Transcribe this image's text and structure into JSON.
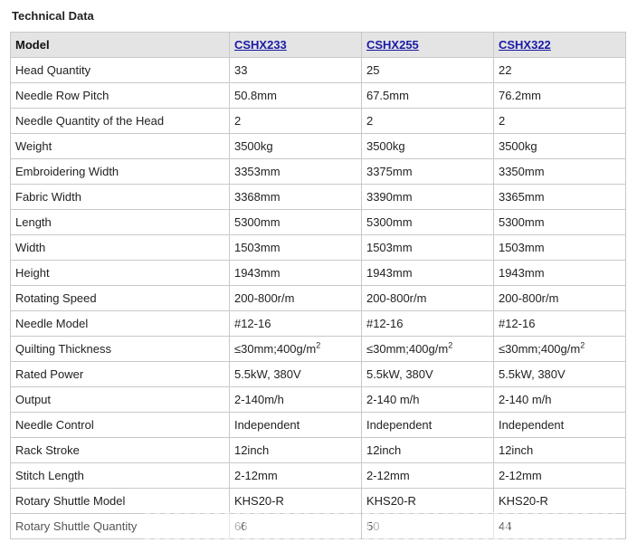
{
  "section_title": "Technical Data",
  "header": {
    "model_label": "Model",
    "models": [
      "CSHX233",
      "CSHX255",
      "CSHX322"
    ]
  },
  "rows": [
    {
      "label": "Head Quantity",
      "values": [
        "33",
        "25",
        "22"
      ]
    },
    {
      "label": "Needle Row Pitch",
      "values": [
        "50.8mm",
        "67.5mm",
        "76.2mm"
      ]
    },
    {
      "label": "Needle Quantity of the Head",
      "values": [
        "2",
        "2",
        "2"
      ]
    },
    {
      "label": "Weight",
      "values": [
        "3500kg",
        "3500kg",
        "3500kg"
      ]
    },
    {
      "label": "Embroidering Width",
      "values": [
        "3353mm",
        "3375mm",
        "3350mm"
      ]
    },
    {
      "label": "Fabric Width",
      "values": [
        "3368mm",
        "3390mm",
        "3365mm"
      ]
    },
    {
      "label": "Length",
      "values": [
        "5300mm",
        "5300mm",
        "5300mm"
      ]
    },
    {
      "label": "Width",
      "values": [
        "1503mm",
        "1503mm",
        "1503mm"
      ]
    },
    {
      "label": "Height",
      "values": [
        "1943mm",
        "1943mm",
        "1943mm"
      ]
    },
    {
      "label": "Rotating Speed",
      "values": [
        "200-800r/m",
        "200-800r/m",
        "200-800r/m"
      ]
    },
    {
      "label": "Needle Model",
      "values": [
        "#12-16",
        "#12-16",
        "#12-16"
      ]
    },
    {
      "label": "Quilting Thickness",
      "values": [
        "≤30mm;400g/m",
        "≤30mm;400g/m",
        "≤30mm;400g/m"
      ],
      "sup": "2"
    },
    {
      "label": "Rated Power",
      "values": [
        "5.5kW, 380V",
        "5.5kW, 380V",
        "5.5kW, 380V"
      ]
    },
    {
      "label": "Output",
      "values": [
        "2-140m/h",
        "2-140 m/h",
        "2-140 m/h"
      ]
    },
    {
      "label": "Needle Control",
      "values": [
        "Independent",
        "Independent",
        "Independent"
      ]
    },
    {
      "label": "Rack Stroke",
      "values": [
        "12inch",
        "12inch",
        "12inch"
      ]
    },
    {
      "label": "Stitch Length",
      "values": [
        "2-12mm",
        "2-12mm",
        "2-12mm"
      ]
    },
    {
      "label": "Rotary Shuttle Model",
      "values": [
        "KHS20-R",
        "KHS20-R",
        "KHS20-R"
      ]
    },
    {
      "label": "Rotary Shuttle Quantity",
      "values": [
        "66",
        "50",
        "44"
      ]
    }
  ]
}
